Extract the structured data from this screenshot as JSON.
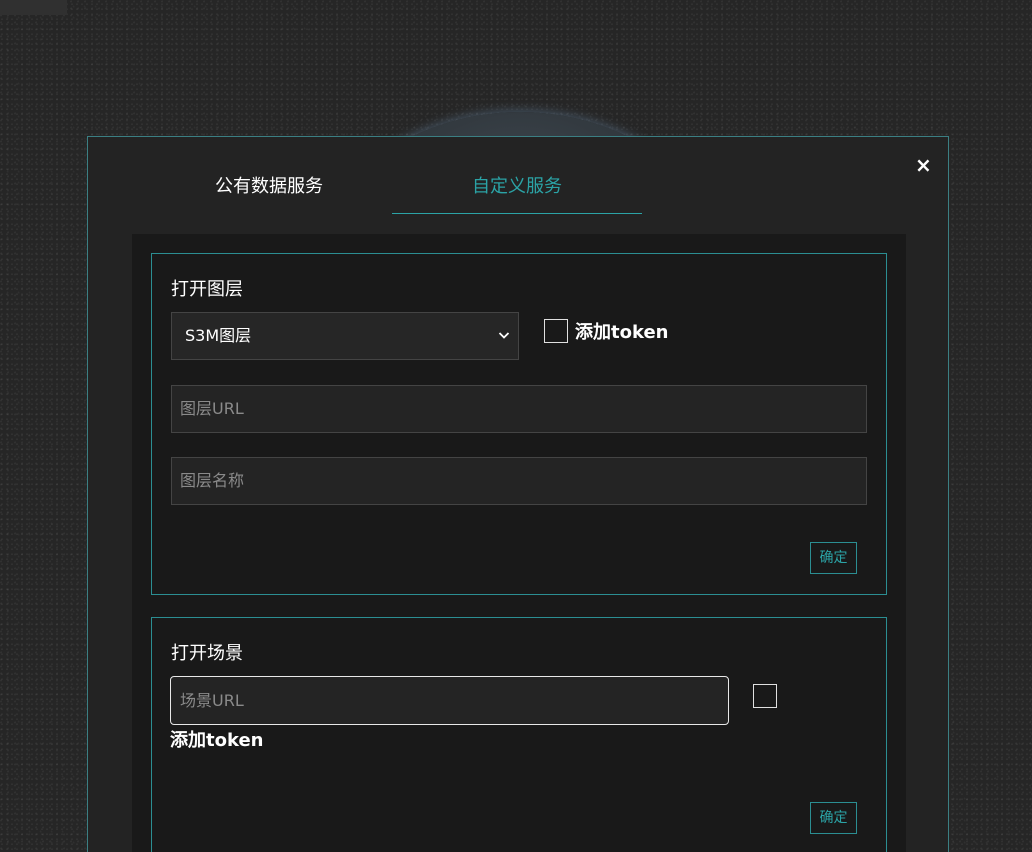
{
  "dialog": {
    "close_symbol": "×",
    "tabs": [
      {
        "label": "公有数据服务"
      },
      {
        "label": "自定义服务"
      }
    ]
  },
  "open_layer": {
    "title": "打开图层",
    "layer_type_selected": "S3M图层",
    "add_token_label": "添加token",
    "url_placeholder": "图层URL",
    "name_placeholder": "图层名称",
    "confirm_label": "确定"
  },
  "open_scene": {
    "title": "打开场景",
    "url_placeholder": "场景URL",
    "add_token_label": "添加token",
    "confirm_label": "确定"
  },
  "colors": {
    "accent": "#2ba3a6",
    "border": "#2b8e92",
    "dialog_bg": "#232323",
    "panel_bg": "#191919"
  },
  "icons": {
    "close": "close-icon",
    "select": "chevron-down-icon"
  }
}
